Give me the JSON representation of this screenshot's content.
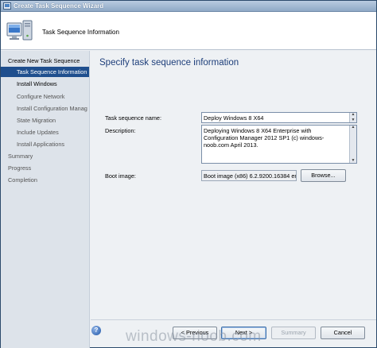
{
  "window": {
    "title": "Create Task Sequence Wizard"
  },
  "header": {
    "title": "Task Sequence Information",
    "icon": "computer-icon"
  },
  "sidebar": {
    "items": [
      {
        "label": "Create New Task Sequence",
        "level": "top",
        "state": "done"
      },
      {
        "label": "Task Sequence Information",
        "level": "sub",
        "state": "active"
      },
      {
        "label": "Install Windows",
        "level": "sub",
        "state": "done"
      },
      {
        "label": "Configure Network",
        "level": "sub",
        "state": "pending"
      },
      {
        "label": "Install Configuration Manag",
        "level": "sub",
        "state": "pending"
      },
      {
        "label": "State Migration",
        "level": "sub",
        "state": "pending"
      },
      {
        "label": "Include Updates",
        "level": "sub",
        "state": "pending"
      },
      {
        "label": "Install Applications",
        "level": "sub",
        "state": "pending"
      },
      {
        "label": "Summary",
        "level": "top",
        "state": "pending"
      },
      {
        "label": "Progress",
        "level": "top",
        "state": "pending"
      },
      {
        "label": "Completion",
        "level": "top",
        "state": "pending"
      }
    ]
  },
  "main": {
    "title": "Specify task sequence information",
    "name_label": "Task sequence name:",
    "name_value": "Deploy Windows 8 X64",
    "description_label": "Description:",
    "description_value": "Deploying Windows 8 X64 Enterprise with Configuration Manager 2012 SP1 (c) windows-noob.com April 2013.",
    "boot_image_label": "Boot image:",
    "boot_image_value": "Boot image (x86) 6.2.9200.16384 en",
    "browse_label": "Browse..."
  },
  "footer": {
    "previous_label": "< Previous",
    "next_label": "Next >",
    "summary_label": "Summary",
    "cancel_label": "Cancel"
  },
  "watermark": "windows-noob.com",
  "colors": {
    "accent": "#1f4f8e",
    "title_blue": "#1d3e7a",
    "sidebar_bg": "#dde3ea"
  }
}
